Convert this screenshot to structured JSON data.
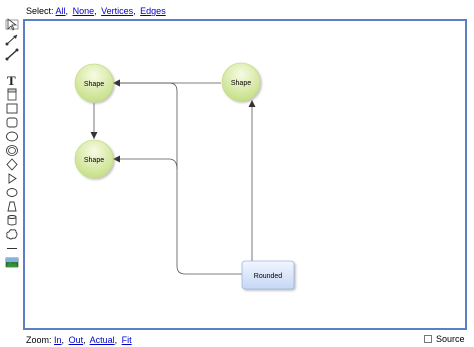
{
  "select_bar": {
    "prefix": "Select:",
    "links": [
      "All",
      "None",
      "Vertices",
      "Edges"
    ]
  },
  "zoom_bar": {
    "prefix": "Zoom:",
    "links": [
      "In",
      "Out",
      "Actual",
      "Fit"
    ]
  },
  "source_toggle": {
    "label": "Source",
    "checked": false
  },
  "toolbar": {
    "tools": [
      "select-icon",
      "connector-icon",
      "line-icon",
      "text-icon",
      "container-icon",
      "rectangle-icon",
      "rounded-rectangle-icon",
      "ellipse-icon",
      "double-ellipse-icon",
      "rhombus-icon",
      "triangle-icon",
      "cylinder-icon",
      "actor-icon",
      "cloud-icon",
      "hline-icon",
      "image-icon"
    ]
  },
  "graph": {
    "vertices": [
      {
        "id": "shape-top-left",
        "label": "Shape"
      },
      {
        "id": "shape-top-right",
        "label": "Shape"
      },
      {
        "id": "shape-bottom-left",
        "label": "Shape"
      },
      {
        "id": "rounded-box",
        "label": "Rounded"
      }
    ]
  },
  "colors": {
    "canvas_border": "#5a7fc6",
    "link": "#0000cc",
    "shape_fill_top": "#f7fbe3",
    "shape_fill_bottom": "#c6df86",
    "rounded_fill_top": "#f2f6ff",
    "rounded_fill_bottom": "#c5d7f5"
  }
}
